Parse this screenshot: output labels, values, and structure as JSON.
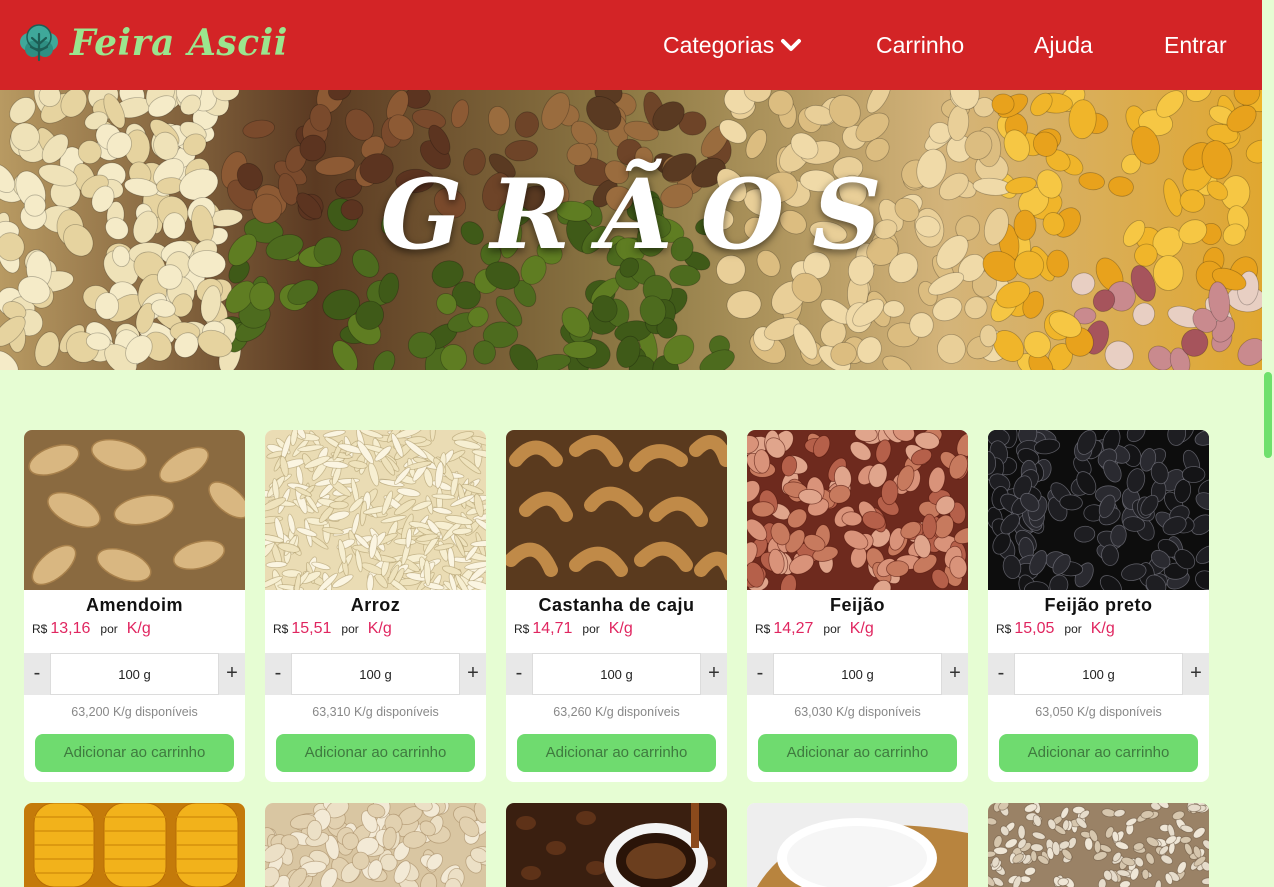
{
  "brand": {
    "name": "Feira Ascii"
  },
  "nav": {
    "categorias": "Categorias",
    "carrinho": "Carrinho",
    "ajuda": "Ajuda",
    "entrar": "Entrar"
  },
  "hero": {
    "title": "GRÃOS"
  },
  "colors": {
    "navbar": "#d32426",
    "background": "#e6fdd3",
    "price": "#e02660",
    "button": "#6fdb6f",
    "logo": "#9be58e"
  },
  "products": [
    {
      "name": "Amendoim",
      "currency": "R$",
      "price": "13,16",
      "per": "por",
      "unit": "K/g",
      "qty_minus": "-",
      "qty_plus": "+",
      "qty": "100 g",
      "stock": "63,200 K/g disponíveis",
      "add_label": "Adicionar ao carrinho"
    },
    {
      "name": "Arroz",
      "currency": "R$",
      "price": "15,51",
      "per": "por",
      "unit": "K/g",
      "qty_minus": "-",
      "qty_plus": "+",
      "qty": "100 g",
      "stock": "63,310 K/g disponíveis",
      "add_label": "Adicionar ao carrinho"
    },
    {
      "name": "Castanha de caju",
      "currency": "R$",
      "price": "14,71",
      "per": "por",
      "unit": "K/g",
      "qty_minus": "-",
      "qty_plus": "+",
      "qty": "100 g",
      "stock": "63,260 K/g disponíveis",
      "add_label": "Adicionar ao carrinho"
    },
    {
      "name": "Feijão",
      "currency": "R$",
      "price": "14,27",
      "per": "por",
      "unit": "K/g",
      "qty_minus": "-",
      "qty_plus": "+",
      "qty": "100 g",
      "stock": "63,030 K/g disponíveis",
      "add_label": "Adicionar ao carrinho"
    },
    {
      "name": "Feijão preto",
      "currency": "R$",
      "price": "15,05",
      "per": "por",
      "unit": "K/g",
      "qty_minus": "-",
      "qty_plus": "+",
      "qty": "100 g",
      "stock": "63,050 K/g disponíveis",
      "add_label": "Adicionar ao carrinho"
    }
  ]
}
